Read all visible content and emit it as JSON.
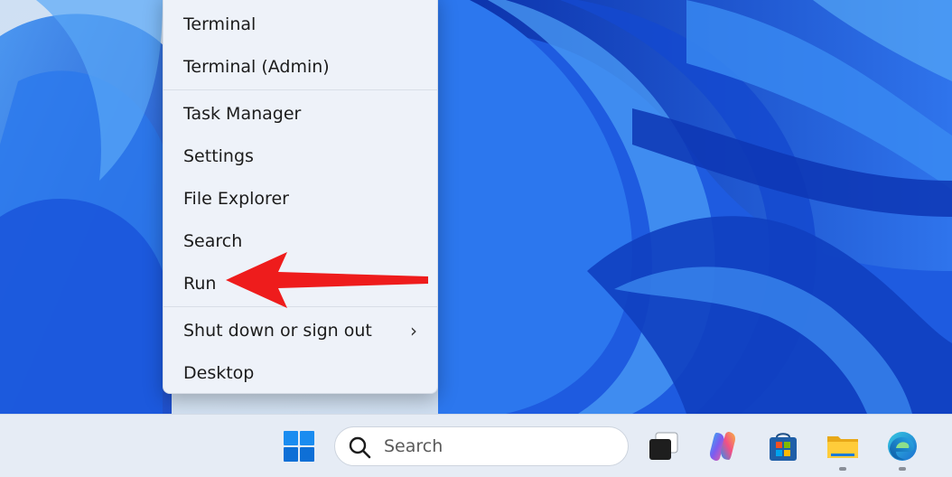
{
  "menu": {
    "items": [
      {
        "label": "Terminal"
      },
      {
        "label": "Terminal (Admin)"
      },
      {
        "label": "Task Manager"
      },
      {
        "label": "Settings"
      },
      {
        "label": "File Explorer"
      },
      {
        "label": "Search"
      },
      {
        "label": "Run"
      },
      {
        "label": "Shut down or sign out",
        "submenu_icon": "chevron-right-icon",
        "chevron": "›"
      },
      {
        "label": "Desktop"
      }
    ]
  },
  "annotation": {
    "arrow_color": "#ee1c1c",
    "points_to": "Run"
  },
  "taskbar": {
    "search_placeholder": "Search",
    "icons": [
      "windows-start-icon",
      "search-icon",
      "task-view-icon",
      "copilot-icon",
      "microsoft-store-icon",
      "file-explorer-icon",
      "edge-browser-icon"
    ]
  },
  "colors": {
    "accent": "#0067c0",
    "wallpaper_blue": "#1f5ee0"
  }
}
